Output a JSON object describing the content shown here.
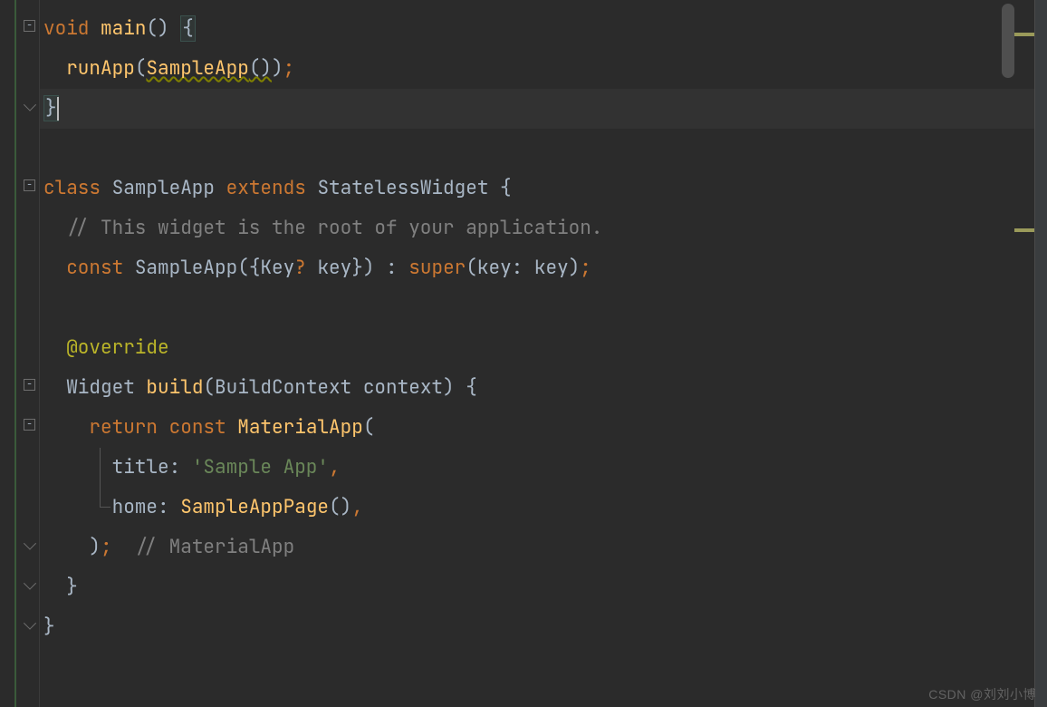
{
  "code": {
    "line1": {
      "kw1": "void",
      "fn": "main",
      "paren": "()",
      "brace": "{"
    },
    "line2": {
      "indent": "  ",
      "fn": "runApp",
      "p1": "(",
      "call": "SampleApp",
      "p2": "()",
      "p3": ")",
      "semi": ";"
    },
    "line3": {
      "brace": "}"
    },
    "line5": {
      "kw1": "class",
      "name": "SampleApp",
      "kw2": "extends",
      "super": "StatelessWidget",
      "brace": "{"
    },
    "line6": {
      "indent": "  ",
      "comment": "// This widget is the root of your application."
    },
    "line7": {
      "indent": "  ",
      "kw1": "const",
      "name": "SampleApp",
      "p1": "({",
      "type": "Key",
      "opt": "?",
      "param": " key",
      "p2": "})",
      "colon": " : ",
      "kw2": "super",
      "p3": "(",
      "named": "key: ",
      "arg": "key",
      "p4": ")",
      "semi": ";"
    },
    "line9": {
      "indent": "  ",
      "anno": "@override"
    },
    "line10": {
      "indent": "  ",
      "type": "Widget",
      "fn": "build",
      "p1": "(",
      "ptype": "BuildContext",
      "param": " context",
      "p2": ")",
      "brace": " {"
    },
    "line11": {
      "indent": "    ",
      "kw1": "return",
      "kw2": "const",
      "call": "MaterialApp",
      "p1": "("
    },
    "line12": {
      "indent": "      ",
      "named": "title: ",
      "str": "'Sample App'",
      "comma": ","
    },
    "line13": {
      "indent": "      ",
      "named": "home: ",
      "call": "SampleAppPage",
      "p1": "()",
      "comma": ","
    },
    "line14": {
      "indent": "    ",
      "p1": ")",
      "semi": ";",
      "hint": "  // MaterialApp"
    },
    "line15": {
      "indent": "  ",
      "brace": "}"
    },
    "line16": {
      "brace": "}"
    }
  },
  "watermark": "CSDN @刘刘小博"
}
